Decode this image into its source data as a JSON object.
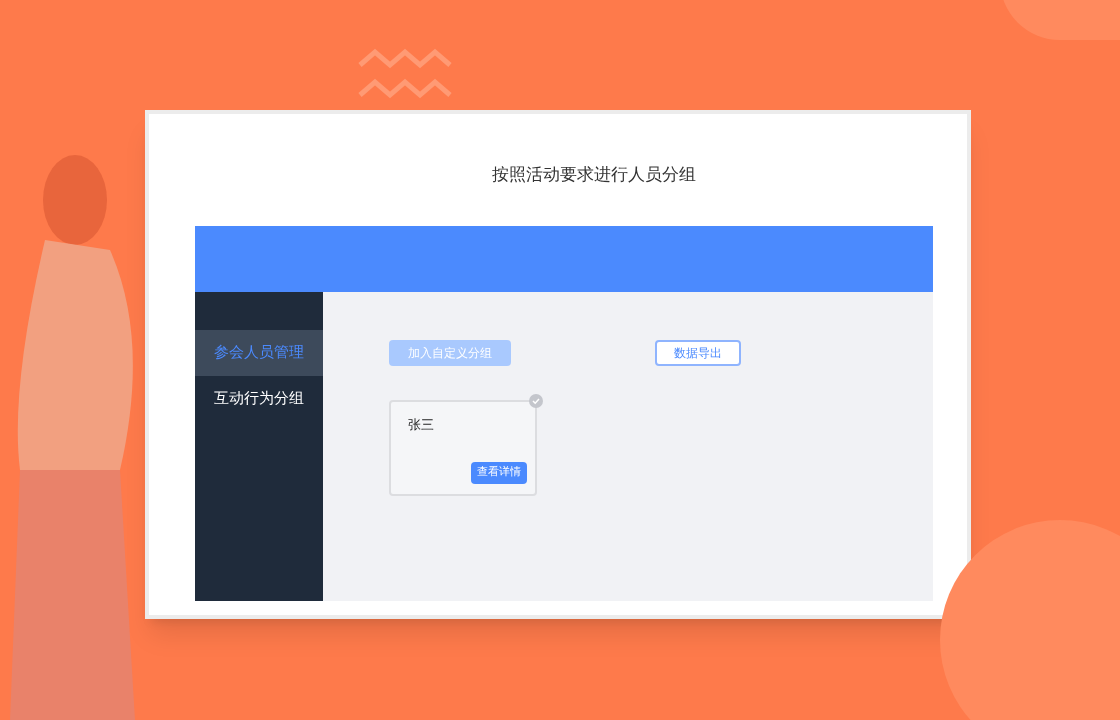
{
  "title": "按照活动要求进行人员分组",
  "sidebar": {
    "items": [
      {
        "label": "参会人员管理",
        "selected": true
      },
      {
        "label": "互动行为分组",
        "selected": false
      }
    ]
  },
  "toolbar": {
    "buttons": [
      {
        "label": "加入自定义分组",
        "kind": "primary",
        "disabled": true
      },
      {
        "label": "数据导出",
        "kind": "outline",
        "disabled": false
      }
    ]
  },
  "cards": [
    {
      "name": "张三",
      "checked": false,
      "action": "查看详情"
    }
  ]
}
